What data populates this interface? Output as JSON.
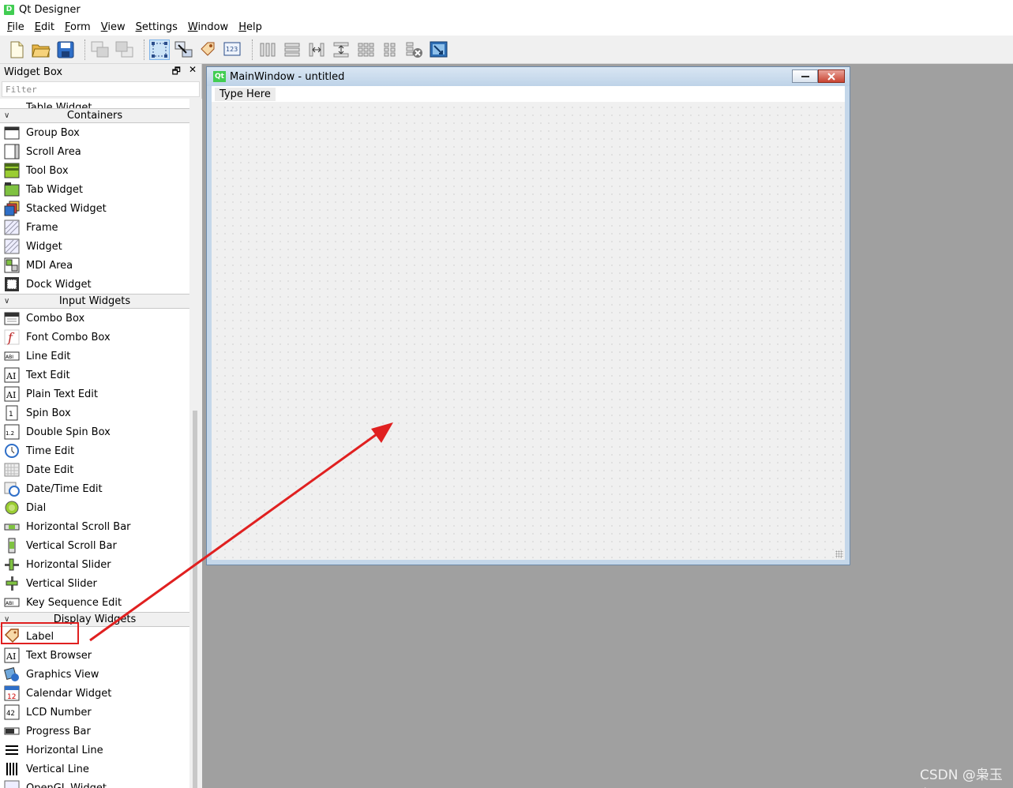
{
  "window": {
    "title": "Qt Designer"
  },
  "menubar": {
    "items": [
      {
        "label": "File",
        "u": "F",
        "rest": "ile"
      },
      {
        "label": "Edit",
        "u": "E",
        "rest": "dit"
      },
      {
        "label": "Form",
        "u": "F",
        "rest": "orm"
      },
      {
        "label": "View",
        "u": "V",
        "rest": "iew"
      },
      {
        "label": "Settings",
        "u": "S",
        "rest": "ettings"
      },
      {
        "label": "Window",
        "u": "W",
        "rest": "indow"
      },
      {
        "label": "Help",
        "u": "H",
        "rest": "elp"
      }
    ]
  },
  "toolbar": {
    "icons": [
      "new-file-icon",
      "open-folder-icon",
      "save-icon",
      "send-to-back-icon",
      "bring-to-front-icon",
      "edit-widgets-icon",
      "edit-signals-slots-icon",
      "edit-buddies-icon",
      "edit-tab-order-icon",
      "layout-horizontal-icon",
      "layout-vertical-icon",
      "layout-horizontal-splitter-icon",
      "layout-vertical-splitter-icon",
      "layout-grid-icon",
      "layout-form-icon",
      "break-layout-icon",
      "adjust-size-icon"
    ]
  },
  "widget_box": {
    "title": "Widget Box",
    "filter_placeholder": "Filter",
    "partial_item": "Table Widget",
    "categories": [
      {
        "name": "Containers",
        "items": [
          "Group Box",
          "Scroll Area",
          "Tool Box",
          "Tab Widget",
          "Stacked Widget",
          "Frame",
          "Widget",
          "MDI Area",
          "Dock Widget"
        ]
      },
      {
        "name": "Input Widgets",
        "items": [
          "Combo Box",
          "Font Combo Box",
          "Line Edit",
          "Text Edit",
          "Plain Text Edit",
          "Spin Box",
          "Double Spin Box",
          "Time Edit",
          "Date Edit",
          "Date/Time Edit",
          "Dial",
          "Horizontal Scroll Bar",
          "Vertical Scroll Bar",
          "Horizontal Slider",
          "Vertical Slider",
          "Key Sequence Edit"
        ]
      },
      {
        "name": "Display Widgets",
        "items": [
          "Label",
          "Text Browser",
          "Graphics View",
          "Calendar Widget",
          "LCD Number",
          "Progress Bar",
          "Horizontal Line",
          "Vertical Line",
          "OpenGL Widget"
        ]
      }
    ]
  },
  "form_window": {
    "title": "MainWindow - untitled",
    "menu_placeholder": "Type Here"
  },
  "watermark": "CSDN @枭玉龙",
  "colors": {
    "annotation": "#e02020",
    "grid_bg": "#f0f0f0",
    "mdi_bg": "#a0a0a0"
  }
}
